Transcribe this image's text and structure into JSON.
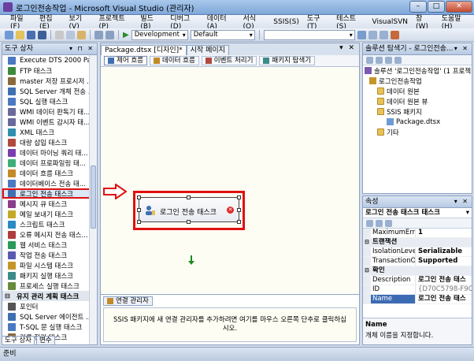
{
  "window": {
    "title": "로그인전송작업 - Microsoft Visual Studio (관리자)"
  },
  "menu": [
    "파일(F)",
    "편집(E)",
    "보기(V)",
    "프로젝트(P)",
    "빌드(B)",
    "디버그(D)",
    "데이터(A)",
    "서식(O)",
    "SSIS(S)",
    "도구(T)",
    "테스트(S)",
    "VisualSVN",
    "창(W)",
    "도움말(H)"
  ],
  "toolbar": {
    "config": "Development",
    "platform": "Default"
  },
  "toolbox": {
    "title": "도구 상자",
    "items": [
      {
        "label": "Execute DTS 2000 Pac...",
        "color": "#4a78c2"
      },
      {
        "label": "FTP 태스크",
        "color": "#3d8a3d"
      },
      {
        "label": "master 저장 프로시저 ...",
        "color": "#8a6a3d"
      },
      {
        "label": "SQL Server 개체 전송 ...",
        "color": "#3f6fb0"
      },
      {
        "label": "SQL 실행 태스크",
        "color": "#4a78c2"
      },
      {
        "label": "WMI 데이터 판독기 태...",
        "color": "#6a6a9a"
      },
      {
        "label": "WMI 이벤트 감시자 태...",
        "color": "#6a6a9a"
      },
      {
        "label": "XML 태스크",
        "color": "#2f8fb0"
      },
      {
        "label": "대량 삽입 태스크",
        "color": "#b04a3d"
      },
      {
        "label": "데이터 마이닝 쿼리 태...",
        "color": "#7a3db0"
      },
      {
        "label": "데이터 프로파일링 태...",
        "color": "#3db07a"
      },
      {
        "label": "데이터 흐름 태스크",
        "color": "#c48a2a"
      },
      {
        "label": "데이터베이스 전송 태...",
        "color": "#4a78c2"
      },
      {
        "label": "로그인 전송 태스크",
        "color": "#3f6fb0",
        "selected": true
      },
      {
        "label": "메시지 큐 태스크",
        "color": "#8a3d8a"
      },
      {
        "label": "메일 보내기 태스크",
        "color": "#c4a82a"
      },
      {
        "label": "스크립트 태스크",
        "color": "#2a8ac4"
      },
      {
        "label": "오류 메시지 전송 태스...",
        "color": "#b03d3d"
      },
      {
        "label": "웹 서비스 태스크",
        "color": "#2a9a5a"
      },
      {
        "label": "작업 전송 태스크",
        "color": "#5a5ab0"
      },
      {
        "label": "파일 시스템 태스크",
        "color": "#c4962a"
      },
      {
        "label": "패키지 실행 태스크",
        "color": "#3d8a8a"
      },
      {
        "label": "프로세스 실행 태스크",
        "color": "#6a8a3d"
      }
    ],
    "group": "유지 관리 계획 태스크",
    "group_items": [
      {
        "label": "포인터",
        "color": "#555555"
      },
      {
        "label": "SQL Server 에이전트 ...",
        "color": "#3f6fb0"
      },
      {
        "label": "T-SQL 문 실행 태스크",
        "color": "#4a78c2"
      },
      {
        "label": "기록 정리 태스크",
        "color": "#8a6a3d"
      }
    ],
    "tabs": [
      "도구 상자",
      "변수"
    ]
  },
  "designer": {
    "doc_tabs": [
      "Package.dtsx [디자인]*",
      "시작 페이지"
    ],
    "sub_tabs": [
      "제어 흐름",
      "데이터 흐름",
      "이벤트 처리기",
      "패키지 탐색기"
    ],
    "task_label": "로그인 전송 태스크",
    "conn_tab": "연결 관리자",
    "conn_hint": "SSIS 패키지에 새 연결 관리자를 추가하려면 여기를 마우스 오른쪽 단추로 클릭하십시오."
  },
  "solution": {
    "title": "솔루션 탐색기 - 로그인전송...",
    "items": [
      {
        "label": "솔루션 '로그인전송작업' (1 프로젝",
        "indent": 2,
        "type": "solution"
      },
      {
        "label": "로그인전송작업",
        "indent": 8,
        "type": "project"
      },
      {
        "label": "데이터 원본",
        "indent": 18,
        "type": "folder"
      },
      {
        "label": "데이터 원본 뷰",
        "indent": 18,
        "type": "folder"
      },
      {
        "label": "SSIS 패키지",
        "indent": 18,
        "type": "folder"
      },
      {
        "label": "Package.dtsx",
        "indent": 30,
        "type": "file"
      },
      {
        "label": "기타",
        "indent": 18,
        "type": "folder"
      }
    ]
  },
  "properties": {
    "title": "속성",
    "object": "로그인 전송 태스크 태스크",
    "rows": [
      {
        "name": "MaximumErron",
        "value": "1"
      },
      {
        "name": "트랜잭션",
        "value": "",
        "category": true
      },
      {
        "name": "IsolationLevel",
        "value": "Serializable"
      },
      {
        "name": "TransactionOpt",
        "value": "Supported"
      },
      {
        "name": "확인",
        "value": "",
        "category": true
      },
      {
        "name": "Description",
        "value": "로그인 전송 태스"
      },
      {
        "name": "ID",
        "value": "{D70C5798-F9C",
        "grey": true
      },
      {
        "name": "Name",
        "value": "로그인 전송 태스",
        "selected": true
      }
    ],
    "desc_title": "Name",
    "desc_text": "개체 이름을 지정합니다."
  },
  "status": "준비"
}
